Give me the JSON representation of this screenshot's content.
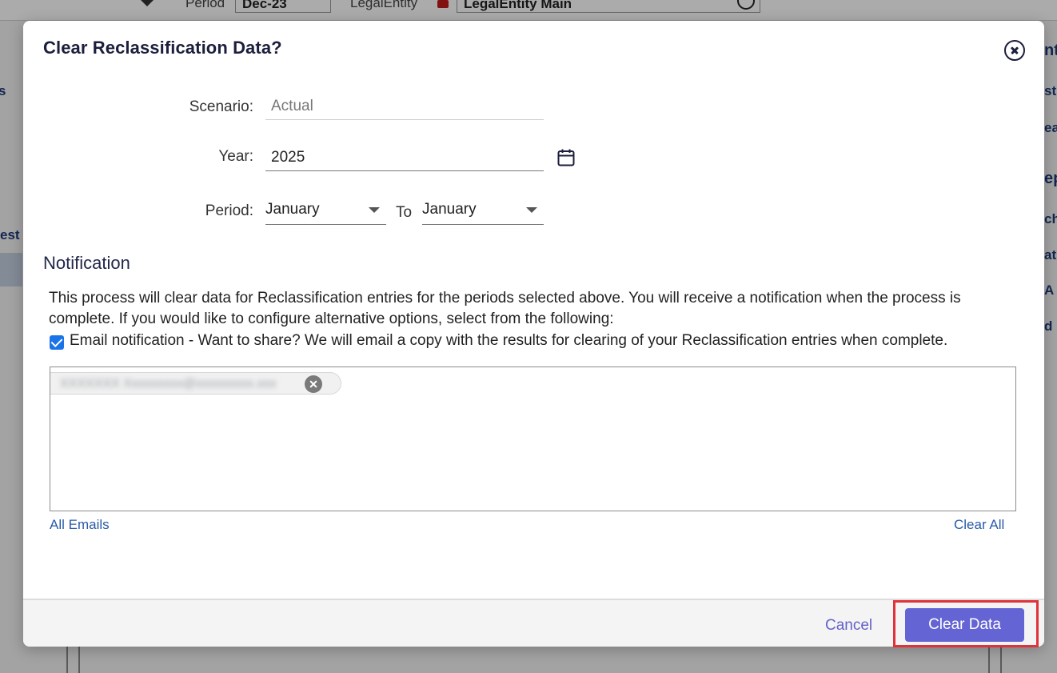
{
  "background": {
    "period_label": "Period",
    "period_value": "Dec-23",
    "entity_label": "LegalEntity",
    "entity_value": "LegalEntity Main",
    "side_left_1": "s",
    "side_left_2": "est",
    "side_right": [
      "ntr",
      "st",
      "ea",
      "ep",
      "ch",
      "atu",
      "A",
      "d"
    ]
  },
  "modal": {
    "title": "Clear Reclassification Data?",
    "fields": {
      "scenario_label": "Scenario:",
      "scenario_value": "Actual",
      "year_label": "Year:",
      "year_value": "2025",
      "period_label": "Period:",
      "period_from": "January",
      "to_label": "To",
      "period_to": "January"
    },
    "notification": {
      "title": "Notification",
      "description": "This process will clear data for Reclassification entries for the periods selected above. You will receive a notification when the process is complete. If you would like to configure alternative options, select from the following:",
      "email_checkbox_label": "Email notification - Want to share? We will email a copy with the results for clearing of your Reclassification entries when complete.",
      "email_checked": true,
      "recipient": "XXXXXXX Xxxxxxxxx@xxxxxxxxx.xxx",
      "all_emails_link": "All Emails",
      "clear_all_link": "Clear All"
    },
    "footer": {
      "cancel_label": "Cancel",
      "primary_label": "Clear Data"
    }
  },
  "colors": {
    "primary": "#6464d4",
    "link": "#2a5aa8",
    "highlight": "#e0323a",
    "checkbox": "#1a73e8"
  }
}
